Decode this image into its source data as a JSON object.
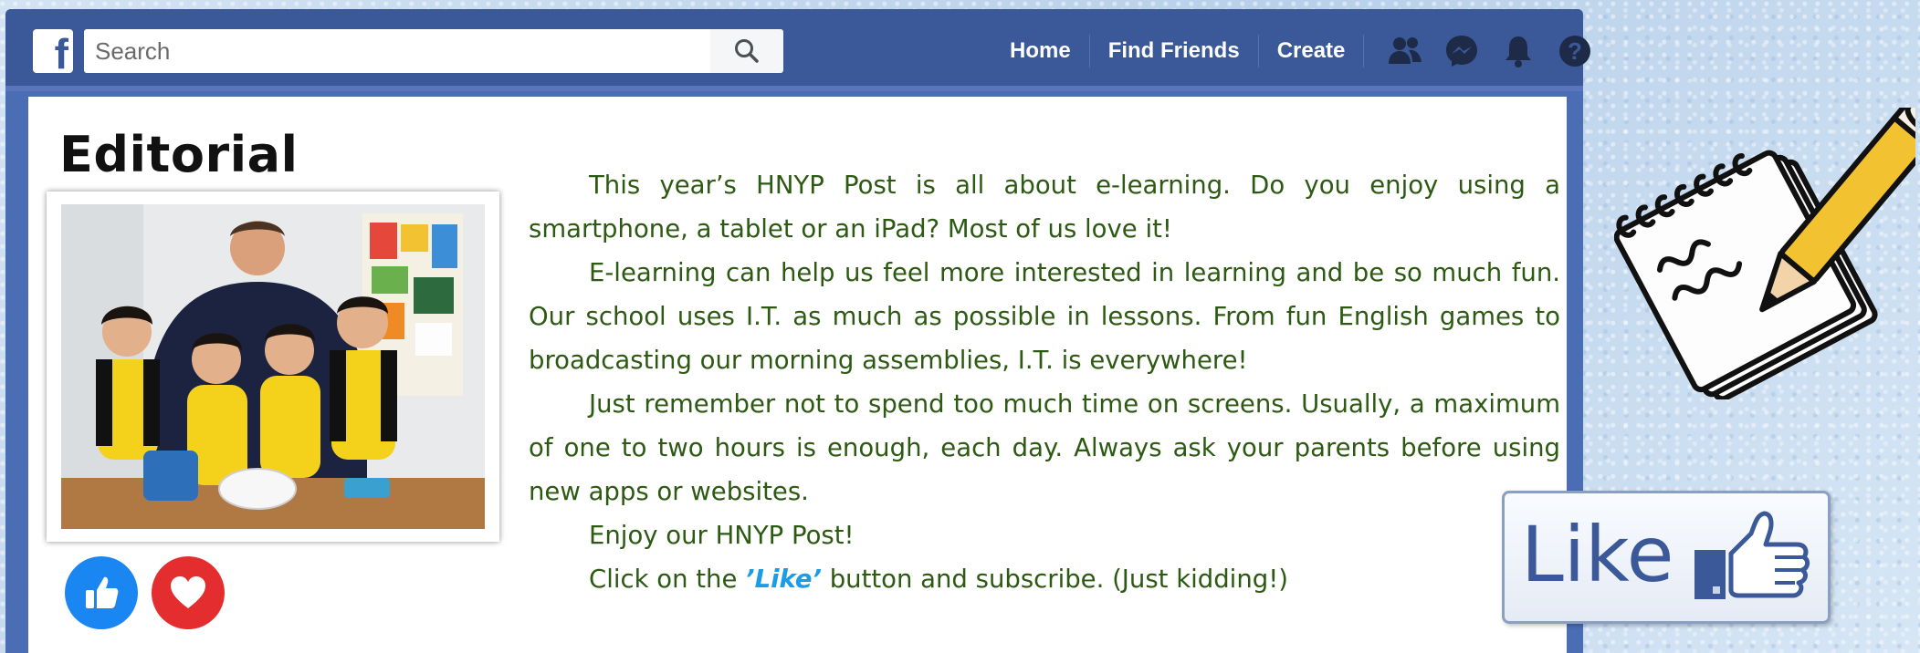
{
  "topbar": {
    "logo": "f",
    "search": {
      "placeholder": "Search",
      "value": ""
    },
    "nav": {
      "home": "Home",
      "find_friends": "Find Friends",
      "create": "Create"
    },
    "icons": [
      "search-icon",
      "friends-icon",
      "messenger-icon",
      "notifications-icon",
      "help-icon"
    ]
  },
  "editorial": {
    "title": "Editorial",
    "paragraphs": [
      "This year’s HNYP Post is all about e-learning. Do you enjoy using a smartphone, a tablet or an iPad? Most of us love it!",
      "E-learning can help us feel more interested in learning and be so much fun. Our school uses I.T. as much as possible in lessons. From fun English games to broadcasting our morning assemblies, I.T. is everywhere!",
      "Just remember not to spend too much time on screens. Usually, a maximum of one to two hours is enough, each day. Always ask your parents before using new apps or websites.",
      "Enjoy our HNYP Post!"
    ],
    "last_line": {
      "before": "Click on the ",
      "emphasis": "’Like’",
      "after": " button and subscribe. (Just kidding!)"
    },
    "reactions": [
      "thumbs-up-icon",
      "heart-icon"
    ]
  },
  "like_button": {
    "label": "Like"
  },
  "colors": {
    "facebook_blue": "#3b5998",
    "article_text": "#2c5a12",
    "like_emphasis": "#1c9be6",
    "like_reaction": "#1a86f2",
    "love_reaction": "#e42d2f"
  }
}
